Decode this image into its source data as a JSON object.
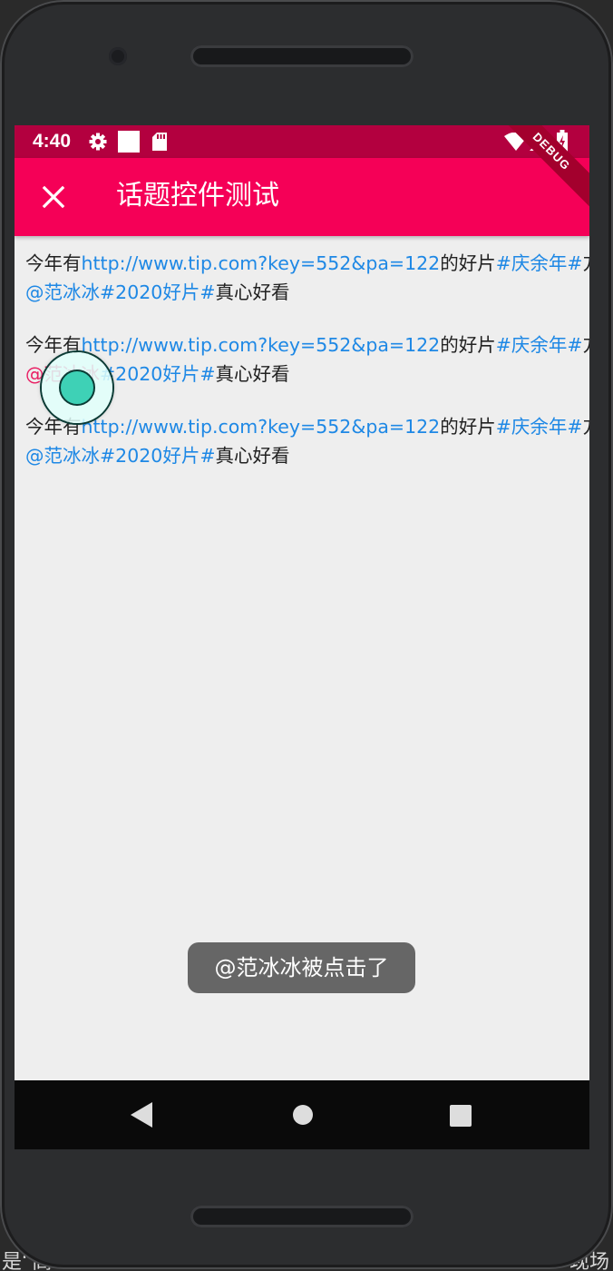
{
  "status_bar": {
    "time": "4:40",
    "icons": [
      "gear-icon",
      "square-icon",
      "sd-card-icon",
      "wifi-icon",
      "signal-icon",
      "battery-charging-icon"
    ]
  },
  "debug_banner": "DEBUG",
  "app_bar": {
    "title": "话题控件测试",
    "close_icon": "close-icon"
  },
  "topics": [
    {
      "line1": {
        "t1": "今年有",
        "url": "http://www.tip.com?key=552&pa=122",
        "t2": "的好片",
        "hashtag": "#庆余年#",
        "t3": "方"
      },
      "line2": {
        "mention": "@范冰冰",
        "hashtag": "#2020好片#",
        "t4": "真心好看"
      }
    },
    {
      "line1": {
        "t1": "今年有",
        "url": "http://www.tip.com?key=552&pa=122",
        "t2": "的好片",
        "hashtag": "#庆余年#",
        "t3": "方"
      },
      "line2": {
        "mention": "@范冰冰",
        "hashtag": "#2020好片#",
        "t4": "真心好看"
      }
    },
    {
      "line1": {
        "t1": "今年有",
        "url": "http://www.tip.com?key=552&pa=122",
        "t2": "的好片",
        "hashtag": "#庆余年#",
        "t3": "方"
      },
      "line2": {
        "mention": "@范冰冰",
        "hashtag": "#2020好片#",
        "t4": "真心好看"
      }
    }
  ],
  "toast": "@范冰冰被点击了",
  "nav_bar": {
    "icons": [
      "back-triangle-icon",
      "home-circle-icon",
      "recents-square-icon"
    ]
  },
  "bottom_text": {
    "left": "是“高",
    "right": "现场"
  },
  "colors": {
    "status_bar": "#b3003f",
    "app_bar": "#f50057",
    "link": "#1e88e5",
    "pressed_mention": "#e91e63",
    "background": "#eeeeee",
    "toast": "#666666",
    "nav_bar": "#0a0a0a"
  }
}
